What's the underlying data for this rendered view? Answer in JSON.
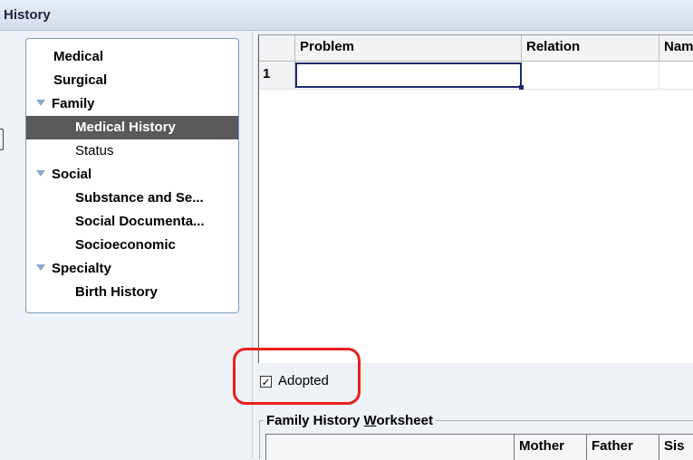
{
  "window": {
    "title": "History"
  },
  "nav": {
    "items": [
      {
        "label": "Medical",
        "level": 1,
        "expanded": null,
        "selected": false,
        "bold": true
      },
      {
        "label": "Surgical",
        "level": 1,
        "expanded": null,
        "selected": false,
        "bold": true
      },
      {
        "label": "Family",
        "level": 1,
        "expanded": true,
        "selected": false,
        "bold": true
      },
      {
        "label": "Medical History",
        "level": 2,
        "expanded": null,
        "selected": true,
        "bold": true
      },
      {
        "label": "Status",
        "level": 2,
        "expanded": null,
        "selected": false,
        "bold": false
      },
      {
        "label": "Social",
        "level": 1,
        "expanded": true,
        "selected": false,
        "bold": true
      },
      {
        "label": "Substance and Se...",
        "level": 2,
        "expanded": null,
        "selected": false,
        "bold": true
      },
      {
        "label": "Social Documenta...",
        "level": 2,
        "expanded": null,
        "selected": false,
        "bold": true
      },
      {
        "label": "Socioeconomic",
        "level": 2,
        "expanded": null,
        "selected": false,
        "bold": true
      },
      {
        "label": "Specialty",
        "level": 1,
        "expanded": true,
        "selected": false,
        "bold": true
      },
      {
        "label": "Birth History",
        "level": 2,
        "expanded": null,
        "selected": false,
        "bold": true
      }
    ]
  },
  "grid": {
    "columns": [
      "Problem",
      "Relation",
      "Nam"
    ],
    "rows": [
      {
        "number": "1",
        "cells": [
          "",
          "",
          ""
        ]
      }
    ]
  },
  "adopted": {
    "label": "Adopted",
    "checked": true,
    "check_glyph": "✓"
  },
  "worksheet": {
    "title_prefix": "Family History ",
    "title_underlined": "W",
    "title_suffix": "orksheet",
    "columns": [
      "",
      "Mother",
      "Father",
      "Sis"
    ]
  },
  "colors": {
    "selected_bg": "#5a5a5a",
    "highlight": "#e8201e",
    "panel_border": "#7f9db9",
    "active_cell_border": "#1d2a6b"
  },
  "icons": {
    "expander": "triangle-down-icon"
  }
}
